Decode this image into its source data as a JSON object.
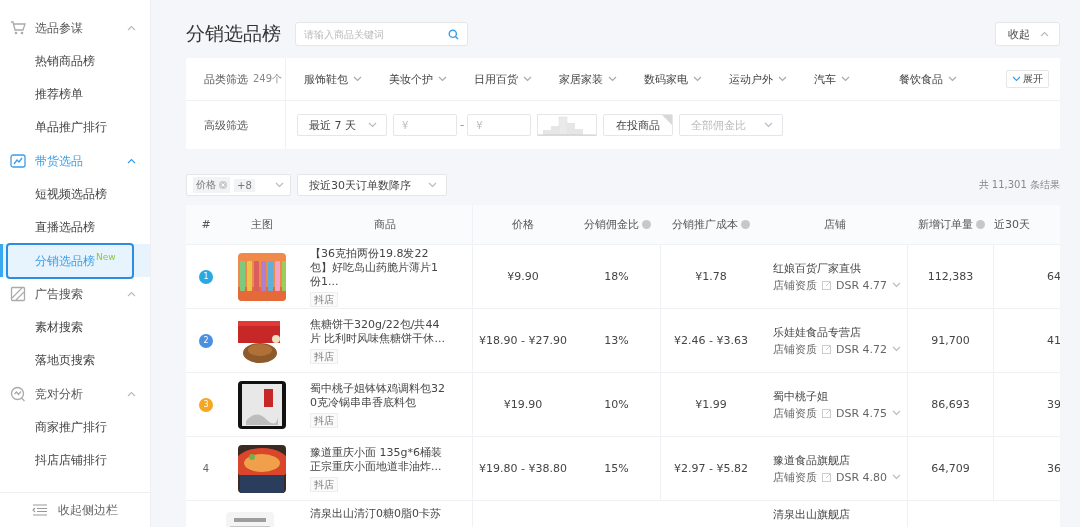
{
  "sidebar": {
    "groups": [
      {
        "label": "选品参谋",
        "active": false,
        "expanded": true,
        "items": [
          {
            "label": "热销商品榜",
            "selected": false
          },
          {
            "label": "推荐榜单",
            "selected": false
          },
          {
            "label": "单品推广排行",
            "selected": false
          }
        ]
      },
      {
        "label": "带货选品",
        "active": true,
        "expanded": true,
        "items": [
          {
            "label": "短视频选品榜",
            "selected": false
          },
          {
            "label": "直播选品榜",
            "selected": false
          },
          {
            "label": "分销选品榜",
            "selected": true,
            "badge": "New"
          }
        ]
      },
      {
        "label": "广告搜索",
        "active": false,
        "expanded": true,
        "items": [
          {
            "label": "素材搜索",
            "selected": false
          },
          {
            "label": "落地页搜索",
            "selected": false
          }
        ]
      },
      {
        "label": "竞对分析",
        "active": false,
        "expanded": true,
        "items": [
          {
            "label": "商家推广排行",
            "selected": false
          },
          {
            "label": "抖店店铺排行",
            "selected": false
          }
        ]
      }
    ],
    "collapse_label": "收起侧边栏"
  },
  "page": {
    "title": "分销选品榜",
    "search": {
      "placeholder": "请输入商品关键词"
    },
    "collapse_button": "收起"
  },
  "filters": {
    "category": {
      "label": "品类筛选",
      "count": "249个",
      "options": [
        "服饰鞋包",
        "美妆个护",
        "日用百货",
        "家居家装",
        "数码家电",
        "运动户外",
        "汽车",
        "餐饮食品"
      ],
      "expand_button": "展开"
    },
    "advanced": {
      "label": "高级筛选",
      "period": "最近 7 天",
      "price_min": {
        "placeholder": "¥"
      },
      "price_max": {
        "placeholder": "¥"
      },
      "separator": "-",
      "in_ad_toggle": "在投商品",
      "commission": {
        "placeholder": "全部佣金比"
      }
    }
  },
  "toolbar": {
    "column_tag": "价格",
    "more_count": "+8",
    "sort": "按近30天订单数降序",
    "result_count": "共 11,301 条结果"
  },
  "table": {
    "columns": [
      {
        "label": "#",
        "help": false
      },
      {
        "label": "主图",
        "help": false
      },
      {
        "label": "商品",
        "help": false
      },
      {
        "label": "价格",
        "help": false
      },
      {
        "label": "分销佣金比",
        "help": true
      },
      {
        "label": "分销推广成本",
        "help": true
      },
      {
        "label": "店铺",
        "help": false
      },
      {
        "label": "新增订单量",
        "help": true
      },
      {
        "label": "近30天",
        "help": false
      }
    ],
    "rows": [
      {
        "rank": "1",
        "kind": "medal",
        "color": "#29a9e1",
        "product": "【36克拍两份19.8发22包】好吃岛山药脆片薄片1份1...",
        "tag": "抖店",
        "price": "¥9.90",
        "commission": "18%",
        "cost": "¥1.78",
        "store": "红娘百货厂家直供",
        "store_label": "店铺资质",
        "dsr": "DSR 4.77",
        "orders": "112,383",
        "column_9": "64"
      },
      {
        "rank": "2",
        "kind": "medal",
        "color": "#4a8fe2",
        "product": "焦糖饼干320g/22包/共44片 比利时风味焦糖饼干休...",
        "tag": "抖店",
        "price": "¥18.90 - ¥27.90",
        "commission": "13%",
        "cost": "¥2.46 - ¥3.63",
        "store": "乐娃娃食品专营店",
        "store_label": "店铺资质",
        "dsr": "DSR 4.72",
        "orders": "91,700",
        "column_9": "41"
      },
      {
        "rank": "3",
        "kind": "medal",
        "color": "#f5a623",
        "product": "蜀中桃子姐钵钵鸡调料包320克冷锅串串香底料包",
        "tag": "抖店",
        "price": "¥19.90",
        "commission": "10%",
        "cost": "¥1.99",
        "store": "蜀中桃子姐",
        "store_label": "店铺资质",
        "dsr": "DSR 4.75",
        "orders": "86,693",
        "column_9": "39"
      },
      {
        "rank": "4",
        "kind": "plain",
        "product": "豫道重庆小面 135g*6桶装正宗重庆小面地道非油炸...",
        "tag": "抖店",
        "price": "¥19.80 - ¥38.80",
        "commission": "15%",
        "cost": "¥2.97 - ¥5.82",
        "store": "豫道食品旗舰店",
        "store_label": "店铺资质",
        "dsr": "DSR 4.80",
        "orders": "64,709",
        "column_9": "36"
      },
      {
        "kind": "partial",
        "product": "清泉出山清汀0糖0脂0卡苏",
        "store": "清泉出山旗舰店"
      }
    ]
  }
}
